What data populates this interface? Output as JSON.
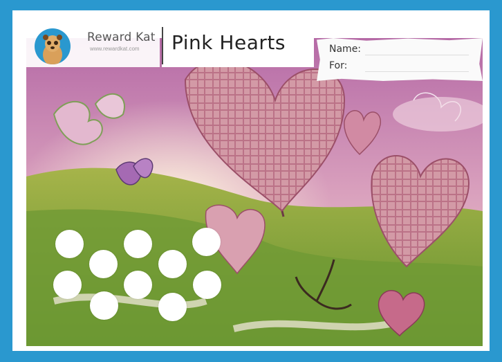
{
  "brand": {
    "name": "Reward Kat",
    "url": "www.rewardkat.com"
  },
  "chart_title": "Pink Hearts",
  "form": {
    "name_label": "Name:",
    "for_label": "For:"
  },
  "sticker_spots": {
    "count": 10
  },
  "colors": {
    "border": "#2a98cf",
    "sky": "#cf8fb0",
    "hill": "#7aa83a",
    "heart": "#c47b8f"
  }
}
